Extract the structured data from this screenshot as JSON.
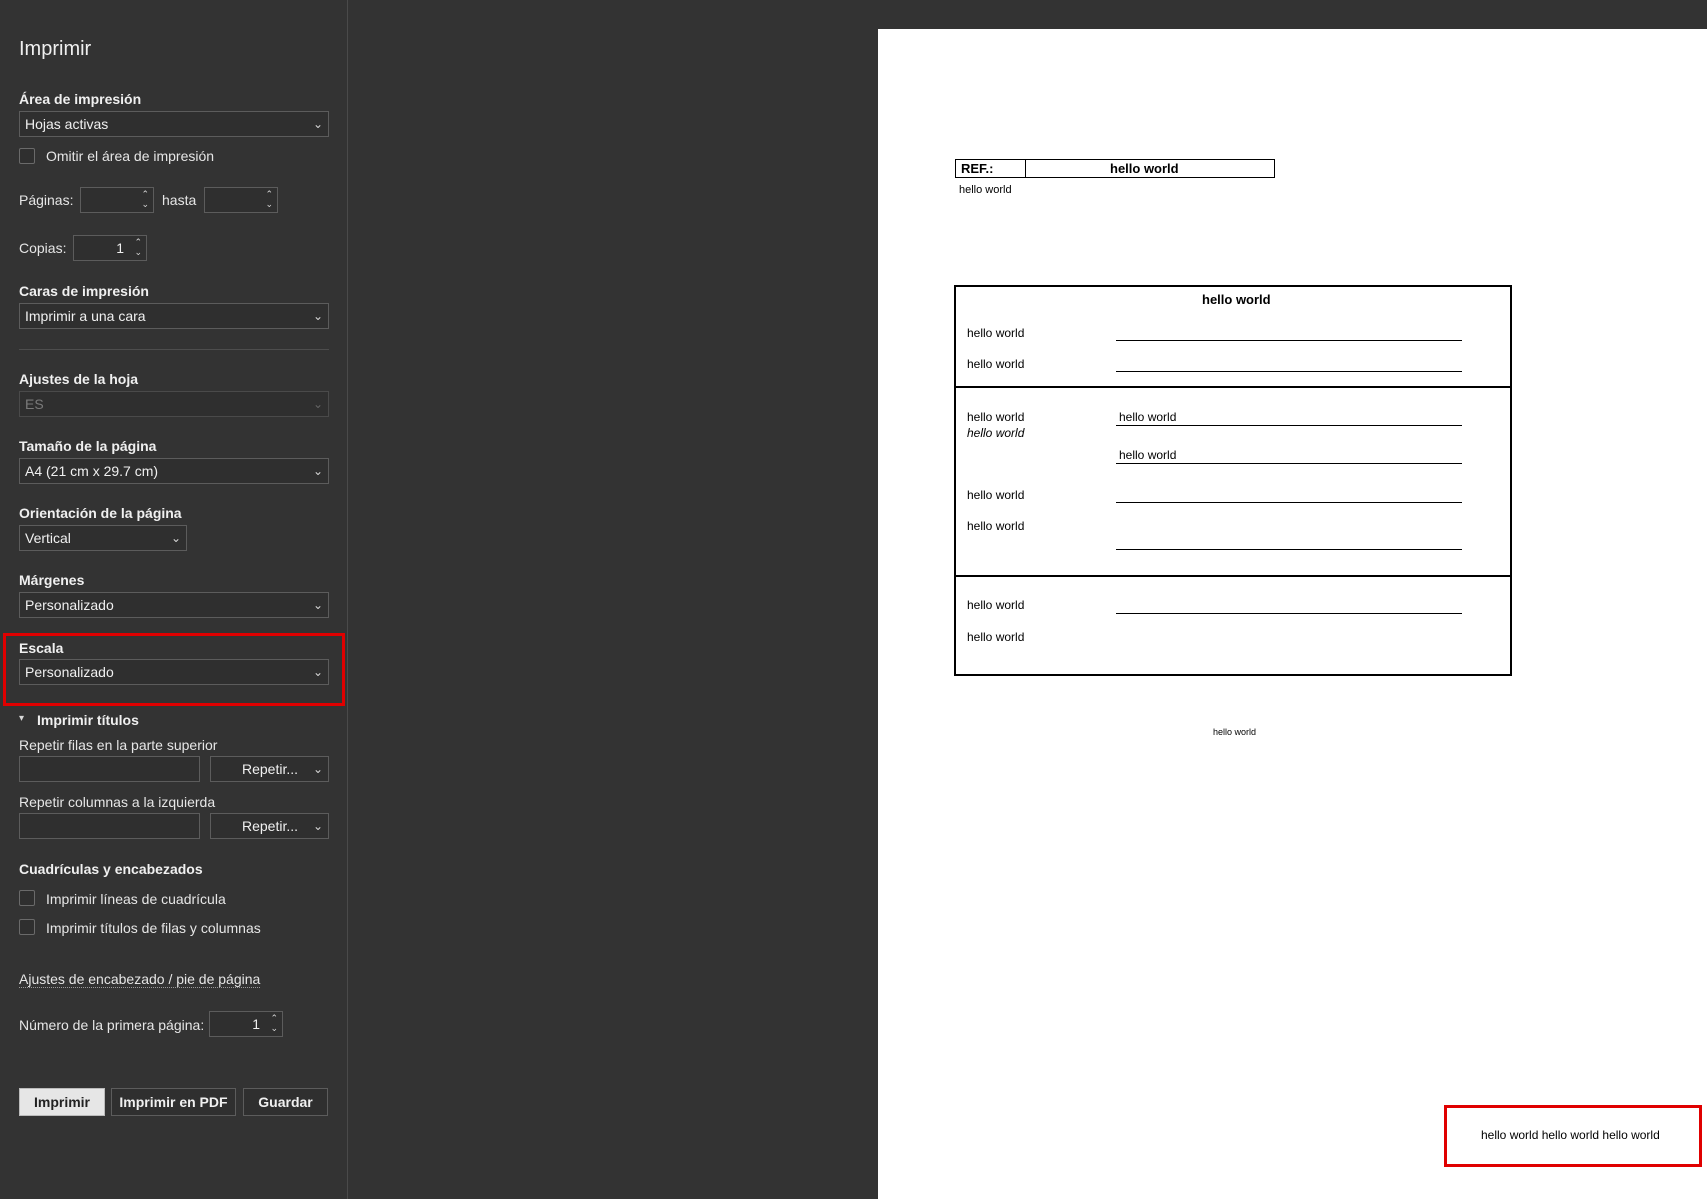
{
  "panel": {
    "title": "Imprimir",
    "print_area": {
      "label": "Área de impresión",
      "value": "Hojas activas",
      "ignore_label": "Omitir el área de impresión"
    },
    "pages": {
      "label": "Páginas:",
      "to_label": "hasta",
      "from_value": "",
      "to_value": ""
    },
    "copies": {
      "label": "Copias:",
      "value": "1"
    },
    "sides": {
      "label": "Caras de impresión",
      "value": "Imprimir a una cara"
    },
    "sheet_settings": {
      "label": "Ajustes de la hoja",
      "value": "ES"
    },
    "page_size": {
      "label": "Tamaño de la página",
      "value": "A4 (21 cm x 29.7 cm)"
    },
    "orientation": {
      "label": "Orientación de la página",
      "value": "Vertical"
    },
    "margins": {
      "label": "Márgenes",
      "value": "Personalizado"
    },
    "scale": {
      "label": "Escala",
      "value": "Personalizado"
    },
    "print_titles": {
      "label": "Imprimir títulos",
      "repeat_rows_label": "Repetir filas en la parte superior",
      "repeat_rows_button": "Repetir...",
      "repeat_cols_label": "Repetir columnas a la izquierda",
      "repeat_cols_button": "Repetir..."
    },
    "gridlines": {
      "label": "Cuadrículas y encabezados",
      "print_gridlines": "Imprimir líneas de cuadrícula",
      "print_headings": "Imprimir títulos de filas y columnas"
    },
    "header_footer_link": "Ajustes de encabezado / pie de página",
    "first_page": {
      "label": "Número de la primera página:",
      "value": "1"
    },
    "buttons": {
      "print": "Imprimir",
      "print_pdf": "Imprimir en PDF",
      "save": "Guardar"
    }
  },
  "preview": {
    "ref_label": "REF.:",
    "ref_value": "hello world",
    "sub_text": "hello world",
    "table_title": "hello world",
    "s1": [
      "hello world",
      "hello world"
    ],
    "s2": {
      "r1_label": "hello world",
      "r1_label_italic": "hello world",
      "r1_value_a": "hello world",
      "r1_value_b": "hello world",
      "r2_label": "hello world",
      "r3_label": "hello world"
    },
    "s3": [
      "hello world",
      "hello world"
    ],
    "center_note": "hello world",
    "footer_text": "hello world hello world hello world"
  },
  "colors": {
    "highlight": "#e00000",
    "panel_bg": "#333333",
    "page_bg": "#ffffff"
  }
}
